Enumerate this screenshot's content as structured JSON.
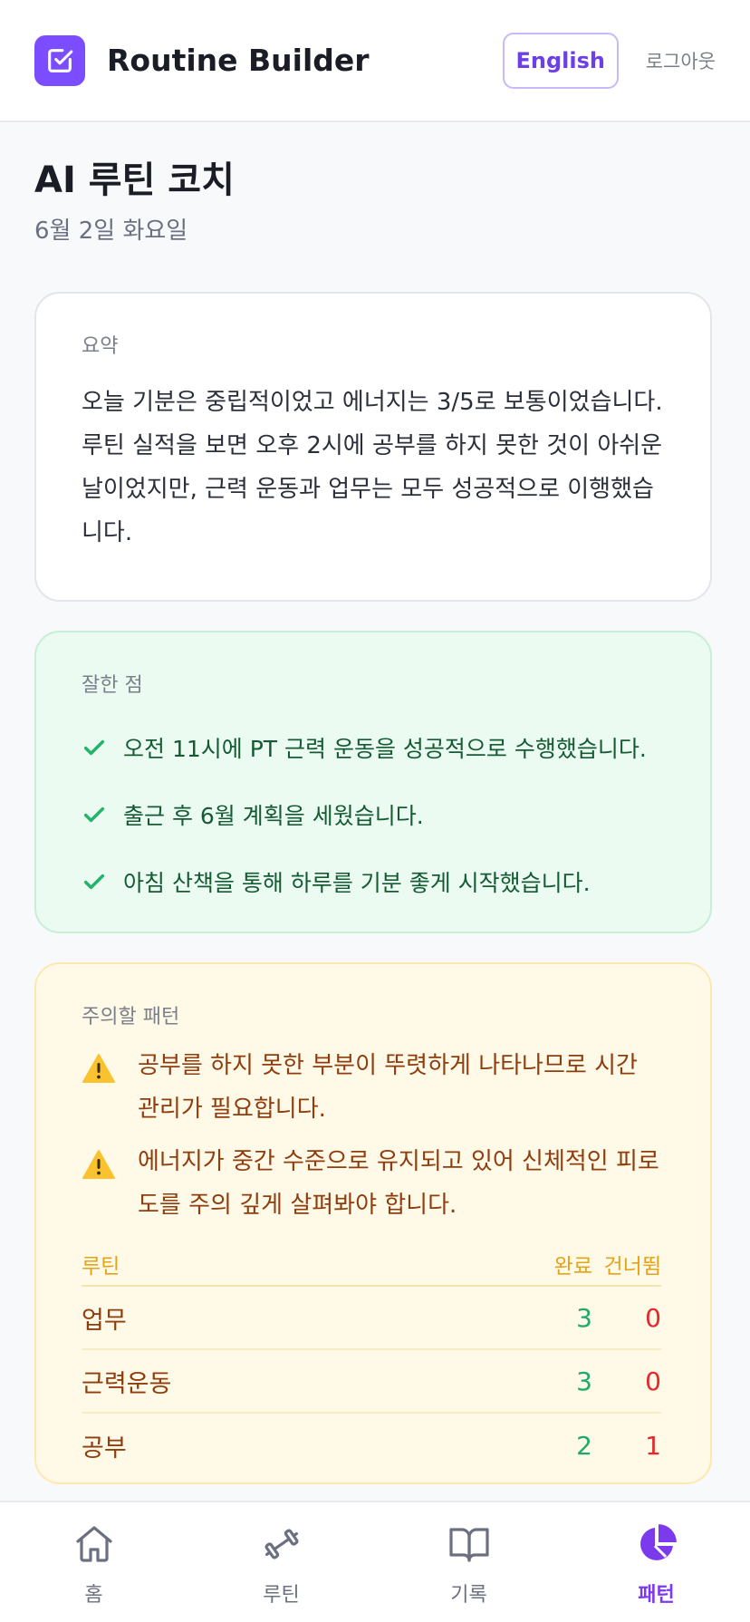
{
  "header": {
    "app_title": "Routine Builder",
    "language_button": "English",
    "logout": "로그아웃"
  },
  "page": {
    "title": "AI 루틴 코치",
    "date": "6월 2일 화요일"
  },
  "summary": {
    "label": "요약",
    "text": "오늘 기분은 중립적이었고 에너지는 3/5로 보통이었습니다. 루틴 실적을 보면 오후 2시에 공부를 하지 못한 것이 아쉬운 날이었지만, 근력 운동과 업무는 모두 성공적으로 이행했습니다."
  },
  "good_points": {
    "label": "잘한 점",
    "items": [
      "오전 11시에 PT 근력 운동을 성공적으로 수행했습니다.",
      "출근 후 6월 계획을 세웠습니다.",
      "아침 산책을 통해 하루를 기분 좋게 시작했습니다."
    ]
  },
  "watch_patterns": {
    "label": "주의할 패턴",
    "items": [
      "공부를 하지 못한 부분이 뚜렷하게 나타나므로 시간 관리가 필요합니다.",
      "에너지가 중간 수준으로 유지되고 있어 신체적인 피로도를 주의 깊게 살펴봐야 합니다."
    ],
    "table": {
      "headers": {
        "routine": "루틴",
        "done": "완료",
        "skipped": "건너뜀"
      },
      "rows": [
        {
          "routine": "업무",
          "done": "3",
          "skipped": "0"
        },
        {
          "routine": "근력운동",
          "done": "3",
          "skipped": "0"
        },
        {
          "routine": "공부",
          "done": "2",
          "skipped": "1"
        }
      ]
    }
  },
  "nav": {
    "items": [
      {
        "label": "홈",
        "icon": "home-icon"
      },
      {
        "label": "루틴",
        "icon": "dumbbell-icon"
      },
      {
        "label": "기록",
        "icon": "book-icon"
      },
      {
        "label": "패턴",
        "icon": "pie-chart-icon",
        "active": true
      }
    ]
  },
  "colors": {
    "brand": "#7c4dff",
    "good_bg": "#ecfbf2",
    "warn_bg": "#fff9e8",
    "done": "#1eaa6a",
    "skipped": "#e5282a"
  }
}
